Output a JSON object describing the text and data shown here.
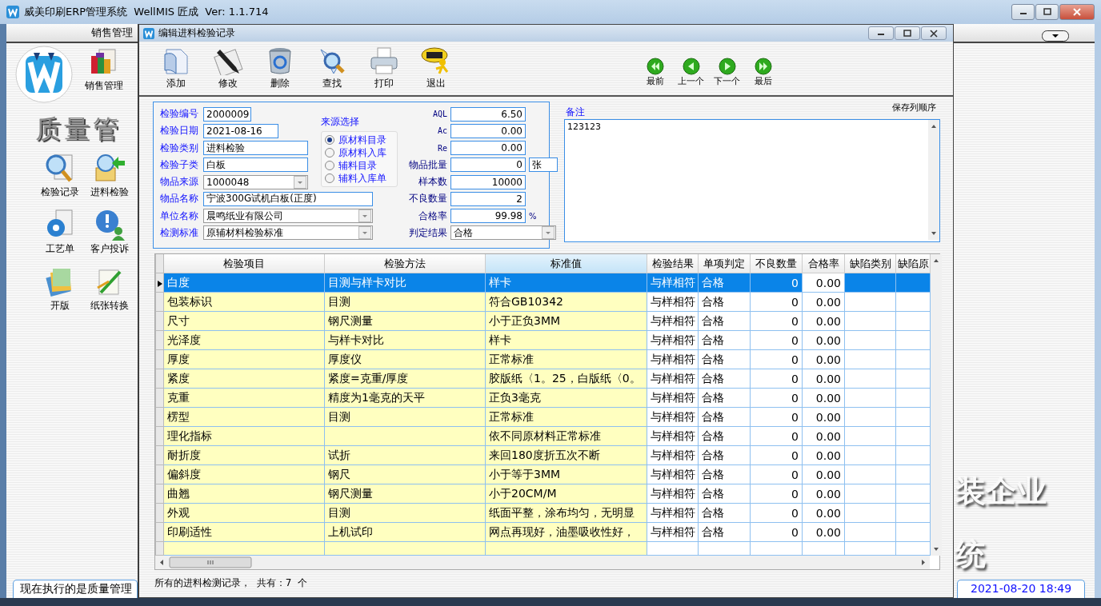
{
  "app": {
    "title": "威美印刷ERP管理系统  WellMIS 匠成  Ver: 1.1.714"
  },
  "sidebar": {
    "header": "销售管理",
    "module": "销售管理",
    "banner": "质量管",
    "items": [
      {
        "kind": "records",
        "label": "检验记录"
      },
      {
        "kind": "incoming",
        "label": "进料检验"
      },
      {
        "kind": "process",
        "label": "工艺单"
      },
      {
        "kind": "complaint",
        "label": "客户投诉"
      },
      {
        "kind": "plate",
        "label": "开版"
      },
      {
        "kind": "paper",
        "label": "纸张转换"
      }
    ],
    "status": "现在执行的是质量管理"
  },
  "background": {
    "lines": [
      "装企业",
      "统"
    ],
    "datetime": "2021-08-20 18:49"
  },
  "dialog": {
    "title": "编辑进料检验记录",
    "toolbar": [
      {
        "kind": "add",
        "label": "添加"
      },
      {
        "kind": "edit",
        "label": "修改"
      },
      {
        "kind": "delete",
        "label": "删除"
      },
      {
        "kind": "find",
        "label": "查找"
      },
      {
        "kind": "print",
        "label": "打印"
      },
      {
        "kind": "exit",
        "label": "退出"
      }
    ],
    "nav": [
      {
        "kind": "first",
        "label": "最前"
      },
      {
        "kind": "prev",
        "label": "上一个"
      },
      {
        "kind": "next",
        "label": "下一个"
      },
      {
        "kind": "last",
        "label": "最后"
      }
    ]
  },
  "form": {
    "fields": [
      {
        "kind": "text",
        "label": "检验编号",
        "value": "2000009"
      },
      {
        "kind": "text",
        "label": "检验日期",
        "value": "2021-08-16"
      },
      {
        "kind": "text",
        "label": "检验类别",
        "value": "进料检验"
      },
      {
        "kind": "text",
        "label": "检验子类",
        "value": "白板"
      },
      {
        "kind": "combo",
        "label": "物品来源",
        "value": "1000048"
      },
      {
        "kind": "text",
        "label": "物品名称",
        "value": "宁波300G试机白板(正度)"
      },
      {
        "kind": "combo",
        "label": "单位名称",
        "value": "晨鸣纸业有限公司"
      },
      {
        "kind": "combo",
        "label": "检测标准",
        "value": "原辅材料检验标准"
      }
    ],
    "source_title": "来源选择",
    "sources": [
      {
        "label": "原材料目录",
        "selected": true
      },
      {
        "label": "原材料入库",
        "selected": false
      },
      {
        "label": "辅料目录",
        "selected": false
      },
      {
        "label": "辅料入库单",
        "selected": false
      }
    ],
    "metrics": [
      {
        "kind": "number",
        "label": "AQL",
        "value": "6.50"
      },
      {
        "kind": "number",
        "label": "Ac",
        "value": "0.00"
      },
      {
        "kind": "number",
        "label": "Re",
        "value": "0.00"
      },
      {
        "kind": "number",
        "label": "物品批量",
        "value": "0",
        "unit": "张"
      },
      {
        "kind": "number",
        "label": "样本数",
        "value": "10000"
      },
      {
        "kind": "number",
        "label": "不良数量",
        "value": "2"
      },
      {
        "kind": "number",
        "label": "合格率",
        "value": "99.98",
        "suffix": "%"
      },
      {
        "kind": "combo",
        "label": "判定结果",
        "value": "合格"
      }
    ]
  },
  "remarks": {
    "label": "备注",
    "value": "123123",
    "save_order": "保存列顺序"
  },
  "grid": {
    "columns": [
      {
        "label": "检验项目",
        "selected": false
      },
      {
        "label": "检验方法",
        "selected": false
      },
      {
        "label": "标准值",
        "selected": true
      },
      {
        "label": "检验结果",
        "selected": false
      },
      {
        "label": "单项判定",
        "selected": false
      },
      {
        "label": "不良数量",
        "selected": false
      },
      {
        "label": "合格率",
        "selected": false
      },
      {
        "label": "缺陷类别",
        "selected": false
      },
      {
        "label": "缺陷原",
        "selected": false
      }
    ],
    "rows": [
      {
        "item": "白度",
        "method": "目测与样卡对比",
        "standard": "样卡",
        "result": "与样相符",
        "judgment": "合格",
        "defects": "0",
        "rate": "0.00",
        "selected": true
      },
      {
        "item": "包装标识",
        "method": "目测",
        "standard": "符合GB10342",
        "result": "与样相符",
        "judgment": "合格",
        "defects": "0",
        "rate": "0.00",
        "selected": false
      },
      {
        "item": "尺寸",
        "method": "钢尺测量",
        "standard": "小于正负3MM",
        "result": "与样相符",
        "judgment": "合格",
        "defects": "0",
        "rate": "0.00",
        "selected": false
      },
      {
        "item": "光泽度",
        "method": "与样卡对比",
        "standard": "样卡",
        "result": "与样相符",
        "judgment": "合格",
        "defects": "0",
        "rate": "0.00",
        "selected": false
      },
      {
        "item": "厚度",
        "method": "厚度仪",
        "standard": "正常标准",
        "result": "与样相符",
        "judgment": "合格",
        "defects": "0",
        "rate": "0.00",
        "selected": false
      },
      {
        "item": "紧度",
        "method": "紧度=克重/厚度",
        "standard": "胶版纸〈1。25，白版纸〈0。",
        "result": "与样相符",
        "judgment": "合格",
        "defects": "0",
        "rate": "0.00",
        "selected": false
      },
      {
        "item": "克重",
        "method": "精度为1毫克的天平",
        "standard": "正负3毫克",
        "result": "与样相符",
        "judgment": "合格",
        "defects": "0",
        "rate": "0.00",
        "selected": false
      },
      {
        "item": "楞型",
        "method": "目测",
        "standard": "正常标准",
        "result": "与样相符",
        "judgment": "合格",
        "defects": "0",
        "rate": "0.00",
        "selected": false
      },
      {
        "item": "理化指标",
        "method": "",
        "standard": "依不同原材料正常标准",
        "result": "与样相符",
        "judgment": "合格",
        "defects": "0",
        "rate": "0.00",
        "selected": false
      },
      {
        "item": "耐折度",
        "method": "试折",
        "standard": "来回180度折五次不断",
        "result": "与样相符",
        "judgment": "合格",
        "defects": "0",
        "rate": "0.00",
        "selected": false
      },
      {
        "item": "偏斜度",
        "method": "钢尺",
        "standard": "小于等于3MM",
        "result": "与样相符",
        "judgment": "合格",
        "defects": "0",
        "rate": "0.00",
        "selected": false
      },
      {
        "item": "曲翘",
        "method": "钢尺测量",
        "standard": "小于20CM/M",
        "result": "与样相符",
        "judgment": "合格",
        "defects": "0",
        "rate": "0.00",
        "selected": false
      },
      {
        "item": "外观",
        "method": "目测",
        "standard": "纸面平整，涂布均匀，无明显",
        "result": "与样相符",
        "judgment": "合格",
        "defects": "0",
        "rate": "0.00",
        "selected": false
      },
      {
        "item": "印刷适性",
        "method": "上机试印",
        "standard": "网点再现好，油墨吸收性好，",
        "result": "与样相符",
        "judgment": "合格",
        "defects": "0",
        "rate": "0.00",
        "selected": false
      }
    ]
  },
  "status": "所有的进料检测记录，  共有：7  个"
}
